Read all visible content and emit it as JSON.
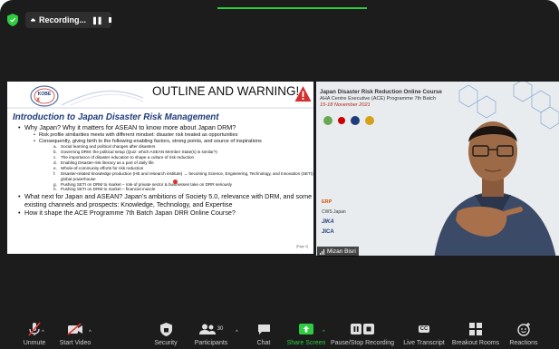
{
  "recording": {
    "label": "Recording...",
    "pause_glyph": "❚❚",
    "stop_glyph": "■"
  },
  "slide": {
    "header_title": "OUTLINE AND WARNING!",
    "logo_text": "KOBE",
    "title": "Introduction to Japan Disaster Risk Management",
    "bullets": [
      {
        "text": "Why Japan? Why it matters for ASEAN to know more about Japan DRM?",
        "sub": [
          {
            "text": "Risk profile similarities meets with different mindset: disaster risk treated as opportunities",
            "sub": []
          },
          {
            "text": "Consequently, giving birth to the following enabling factors, strong points, and source of inspirations",
            "sub": [
              {
                "label": "a.",
                "text": "Social learning and political changes after disasters"
              },
              {
                "label": "b.",
                "text": "Governing DRM: the political setup (Quiz: which ASEAN Member State(s) is similar?)"
              },
              {
                "label": "c.",
                "text": "The importance of disaster education to shape a culture of risk reduction"
              },
              {
                "label": "d.",
                "text": "Enabling Disaster-risk literacy as a part of daily life"
              },
              {
                "label": "e.",
                "text": "Whole-of-community efforts for risk reduction"
              },
              {
                "label": "f.",
                "text": "Disaster-related knowledge production (HE and research institute) → becoming Science, Engineering, Technology, and Innovation (SETI) global powerhouse"
              },
              {
                "label": "g.",
                "text": "Pushing SETI on DRM to market – role of private sector & businesses take on DRR seriously"
              },
              {
                "label": "h.",
                "text": "Pushing SETI on DRM to market – financial muscle"
              }
            ]
          }
        ]
      },
      {
        "text": "What next for Japan and ASEAN? Japan’s ambitions of Society 5.0, relevance with DRM, and some existing channels and prospects: Knowledge, Technology, and Expertise",
        "sub": []
      },
      {
        "text": "How it shape the ACE Programme 7th Batch Japan DRR Online Course?",
        "sub": []
      }
    ],
    "page_number": "[Page 2]"
  },
  "video": {
    "course_title": "Japan Disaster Risk Reduction Online Course",
    "course_sub": "AHA Centre Executive (ACE) Programme 7th Batch",
    "course_date": "15-18 November 2021",
    "participant_name": "Mizan Bisri",
    "side_logos": [
      "ERP",
      "CWS Japan",
      "JIKA",
      "JICA"
    ]
  },
  "toolbar": {
    "unmute": "Unmute",
    "start_video": "Start Video",
    "security": "Security",
    "participants": "Participants",
    "participants_count": "30",
    "chat": "Chat",
    "share_screen": "Share Screen",
    "pause_stop_recording": "Pause/Stop Recording",
    "live_transcript": "Live Transcript",
    "cc_glyph": "CC",
    "breakout_rooms": "Breakout Rooms",
    "reactions": "Reactions"
  },
  "colors": {
    "accent_green": "#2ecc40",
    "slide_title_blue": "#1f3d7a",
    "warning_red": "#d32f2f"
  }
}
